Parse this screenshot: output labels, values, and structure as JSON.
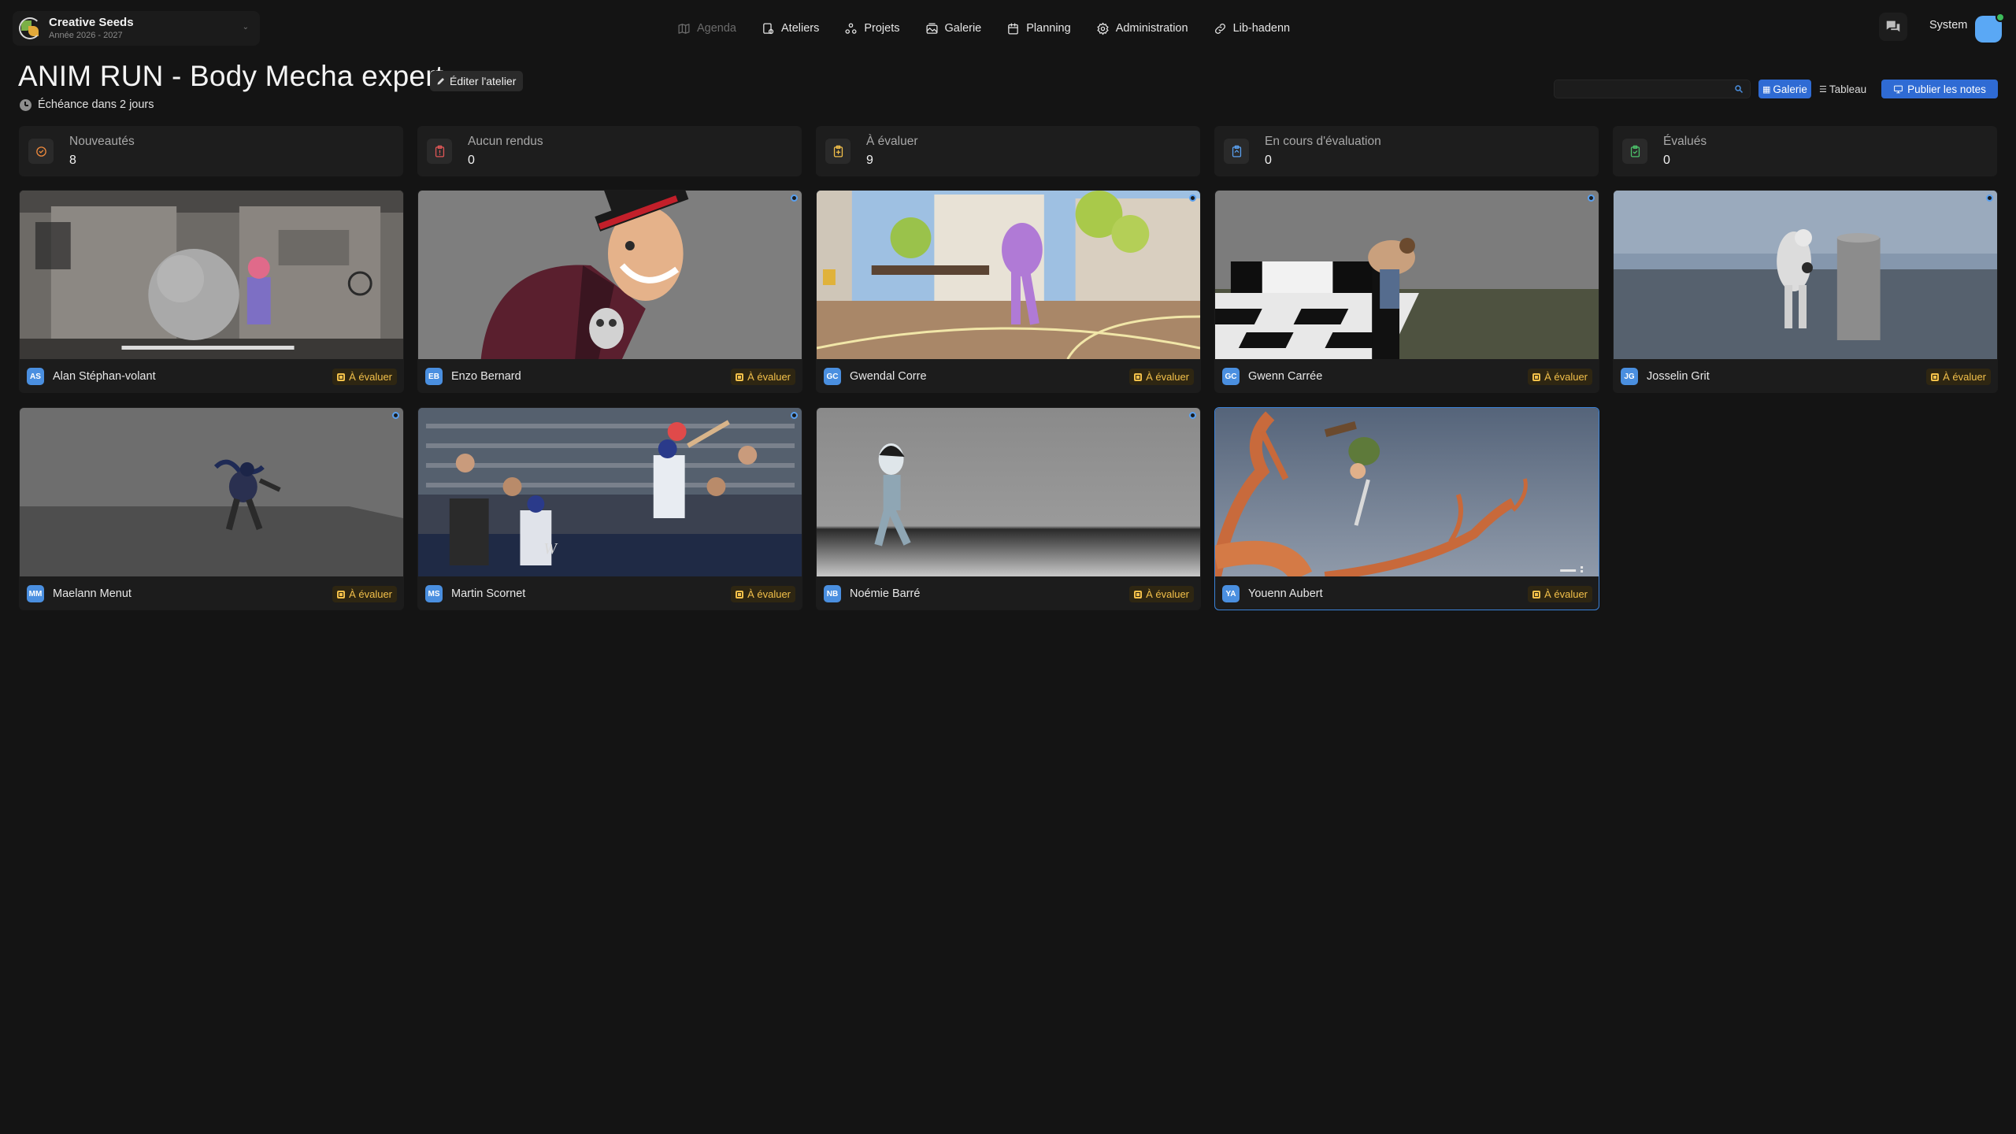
{
  "org": {
    "name": "Creative Seeds",
    "year": "Année 2026 - 2027"
  },
  "nav": [
    {
      "label": "Agenda",
      "icon": "map-icon",
      "disabled": true
    },
    {
      "label": "Ateliers",
      "icon": "workshop-icon"
    },
    {
      "label": "Projets",
      "icon": "projects-icon"
    },
    {
      "label": "Galerie",
      "icon": "gallery-icon"
    },
    {
      "label": "Planning",
      "icon": "calendar-icon"
    },
    {
      "label": "Administration",
      "icon": "gear-icon"
    },
    {
      "label": "Lib-hadenn",
      "icon": "link-icon"
    }
  ],
  "user": {
    "name": "System",
    "status_color": "#3dbb5b"
  },
  "page": {
    "title": "ANIM RUN - Body Mecha expert",
    "edit_label": "Éditer l'atelier",
    "deadline": "Échéance dans 2 jours"
  },
  "toolbar": {
    "search_value": "",
    "search_placeholder": "",
    "view_gallery": "Galerie",
    "view_table": "Tableau",
    "publish": "Publier les notes"
  },
  "stats": [
    {
      "label": "Nouveautés",
      "value": "8",
      "color": "#f08a3c",
      "icon": "sparkle-icon"
    },
    {
      "label": "Aucun rendus",
      "value": "0",
      "color": "#e05656",
      "icon": "empty-clipboard-icon"
    },
    {
      "label": "À évaluer",
      "value": "9",
      "color": "#f3c04a",
      "icon": "clipboard-plus-icon"
    },
    {
      "label": "En cours d'évaluation",
      "value": "0",
      "color": "#5aa0ef",
      "icon": "clipboard-progress-icon"
    },
    {
      "label": "Évalués",
      "value": "0",
      "color": "#4cc26a",
      "icon": "clipboard-check-icon"
    }
  ],
  "status_label": "À évaluer",
  "submissions": [
    {
      "initials": "AS",
      "name": "Alan Stéphan-volant",
      "status": "À évaluer"
    },
    {
      "initials": "EB",
      "name": "Enzo Bernard",
      "status": "À évaluer"
    },
    {
      "initials": "GC",
      "name": "Gwendal Corre",
      "status": "À évaluer"
    },
    {
      "initials": "GC",
      "name": "Gwenn Carrée",
      "status": "À évaluer"
    },
    {
      "initials": "JG",
      "name": "Josselin Grit",
      "status": "À évaluer"
    },
    {
      "initials": "MM",
      "name": "Maelann Menut",
      "status": "À évaluer"
    },
    {
      "initials": "MS",
      "name": "Martin Scornet",
      "status": "À évaluer"
    },
    {
      "initials": "NB",
      "name": "Noémie Barré",
      "status": "À évaluer"
    },
    {
      "initials": "YA",
      "name": "Youenn Aubert",
      "status": "À évaluer"
    }
  ]
}
